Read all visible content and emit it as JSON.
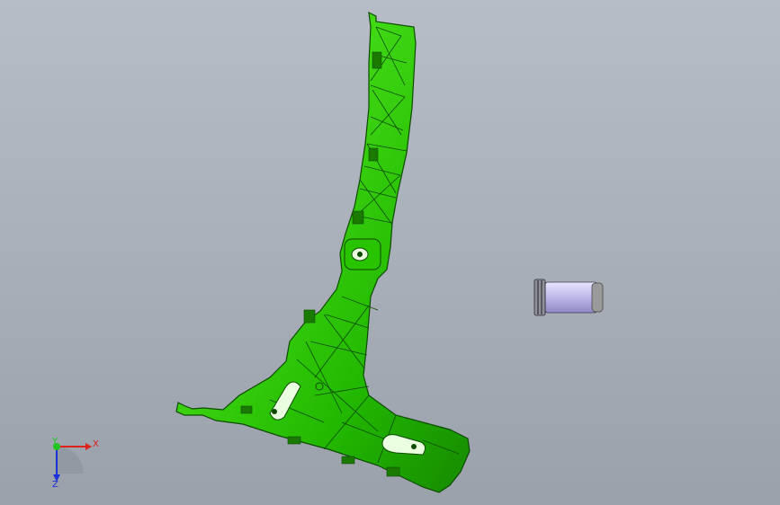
{
  "viewport": {
    "background_top": "#b7bdc6",
    "background_bottom": "#9aa1ab"
  },
  "parts": {
    "bracket": {
      "color": "#2fd400",
      "edge_color": "#0d4a00"
    },
    "cylinder": {
      "body_color": "#c7c2f0",
      "cap_color": "#8a8a8a"
    }
  },
  "triad": {
    "x_label": "X",
    "y_label": "Y",
    "z_label": "Z",
    "x_color": "#e0201a",
    "y_color": "#1ec51e",
    "z_color": "#1b2fd6"
  }
}
